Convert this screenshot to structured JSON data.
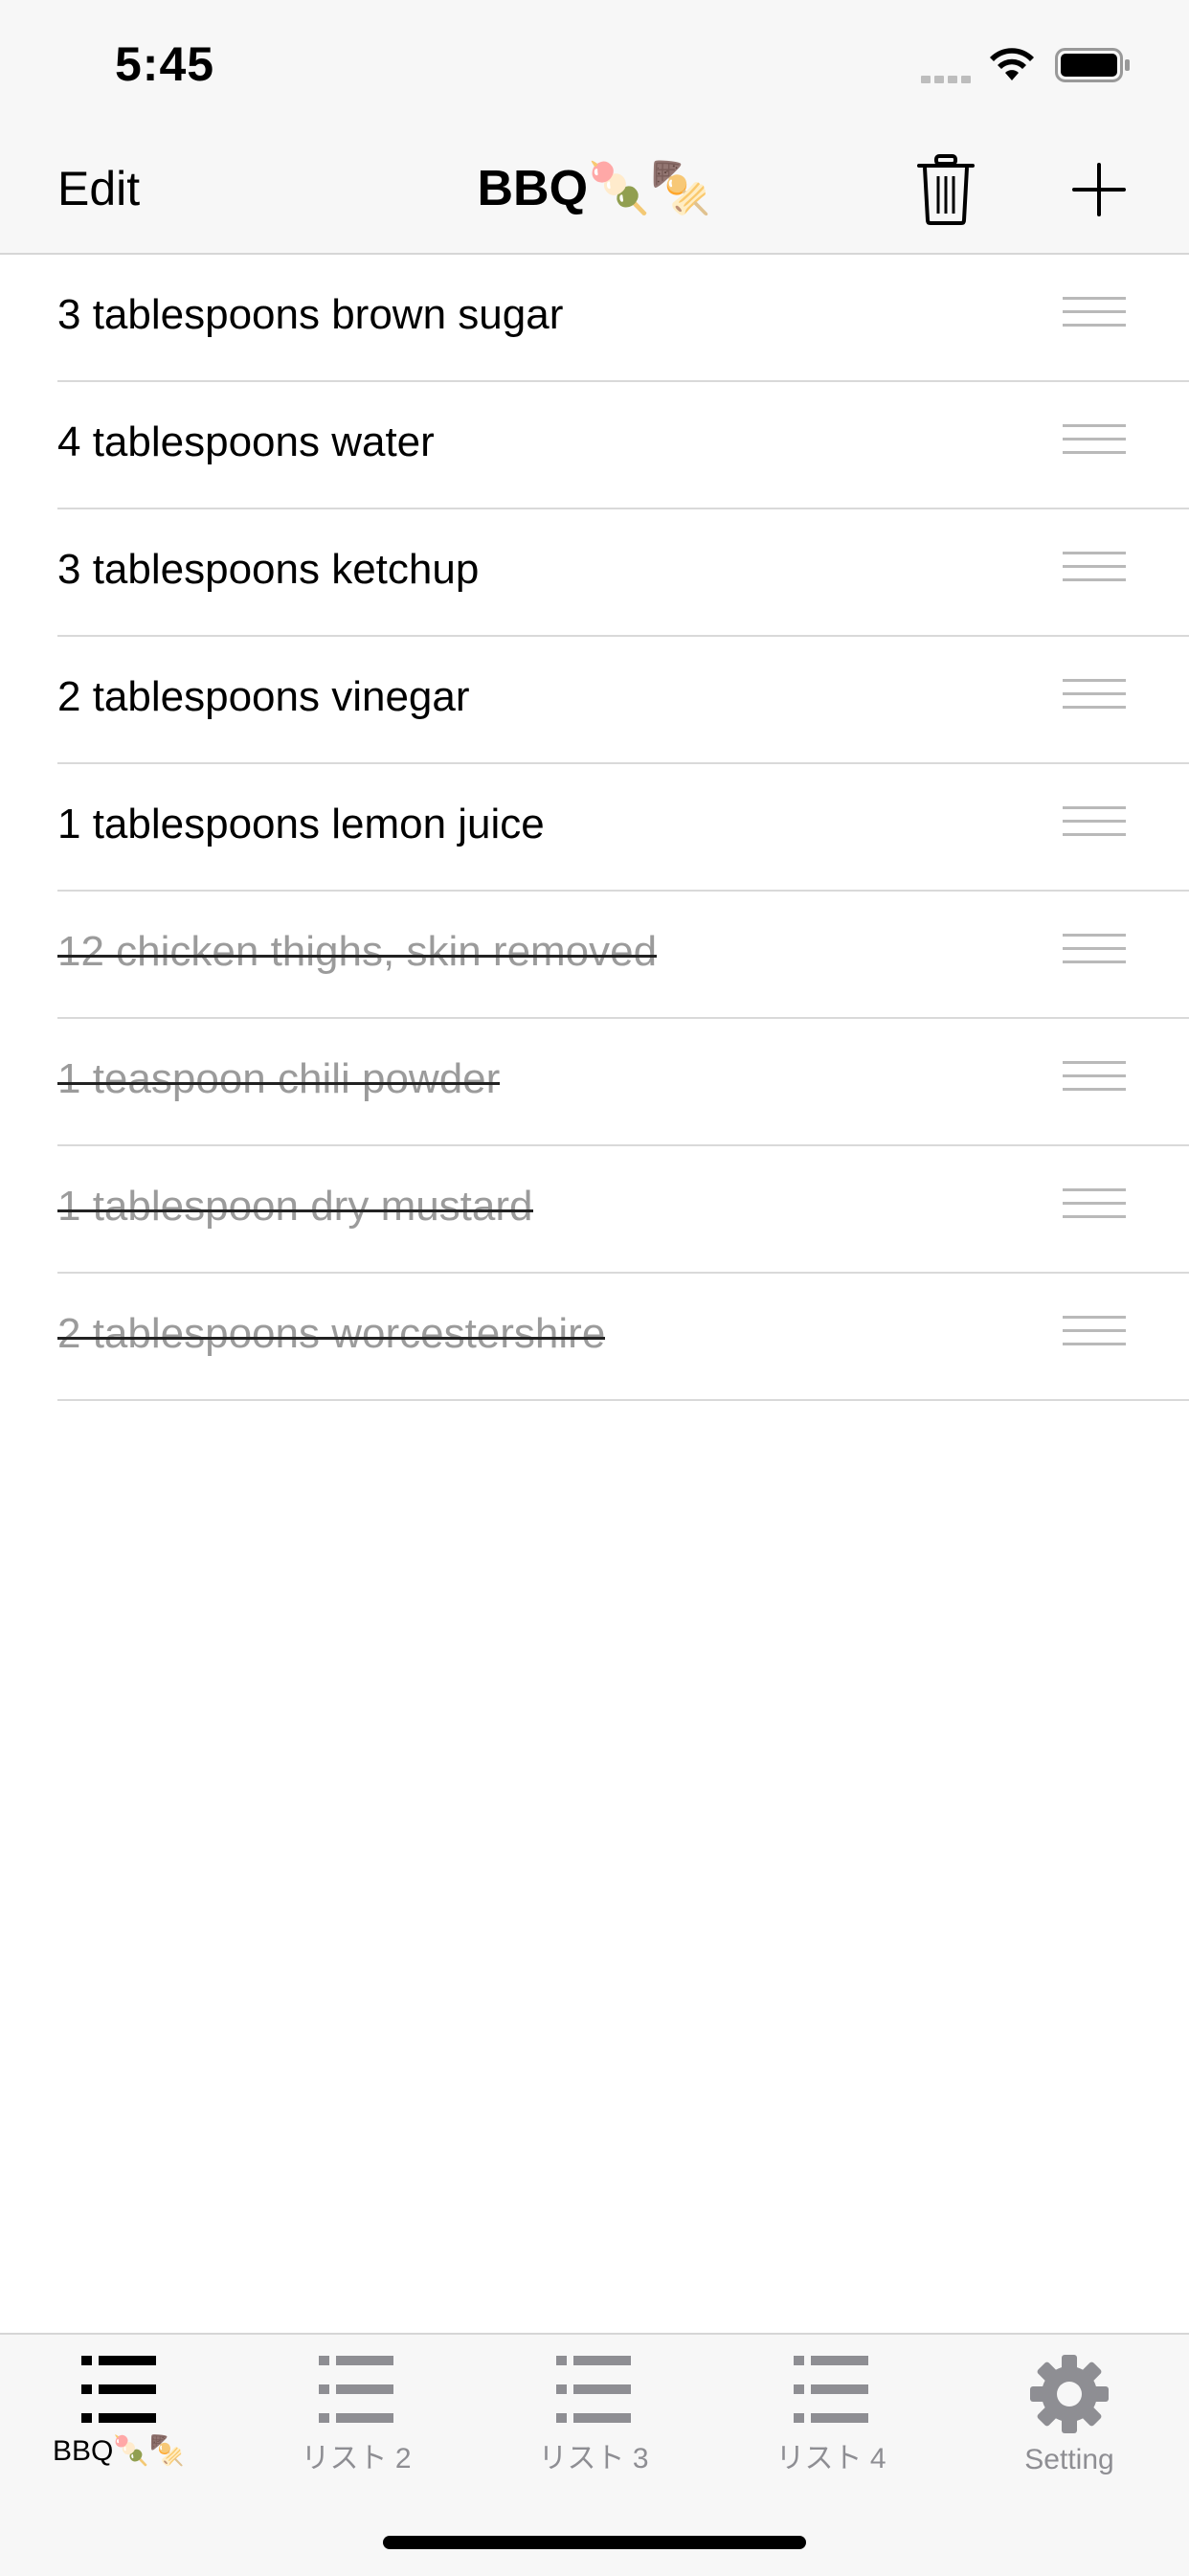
{
  "status_bar": {
    "time": "5:45"
  },
  "nav": {
    "edit_label": "Edit",
    "title": "BBQ🍡🍢"
  },
  "items": [
    {
      "text": "3 tablespoons brown sugar",
      "done": false
    },
    {
      "text": "4 tablespoons water",
      "done": false
    },
    {
      "text": "3 tablespoons ketchup",
      "done": false
    },
    {
      "text": "2 tablespoons vinegar",
      "done": false
    },
    {
      "text": "1 tablespoons lemon juice",
      "done": false
    },
    {
      "text": "12 chicken thighs, skin removed",
      "done": true
    },
    {
      "text": "1 teaspoon chili powder",
      "done": true
    },
    {
      "text": "1 tablespoon dry mustard",
      "done": true
    },
    {
      "text": "2 tablespoons worcestershire",
      "done": true
    }
  ],
  "tabs": [
    {
      "label": "BBQ🍡🍢",
      "icon": "list-icon",
      "active": true
    },
    {
      "label": "リスト 2",
      "icon": "list-icon",
      "active": false
    },
    {
      "label": "リスト 3",
      "icon": "list-icon",
      "active": false
    },
    {
      "label": "リスト 4",
      "icon": "list-icon",
      "active": false
    },
    {
      "label": "Setting",
      "icon": "gear-icon",
      "active": false
    }
  ],
  "colors": {
    "active_tab": "#000000",
    "inactive_tab": "#8e8e93",
    "done_text": "#9b9b9b"
  }
}
